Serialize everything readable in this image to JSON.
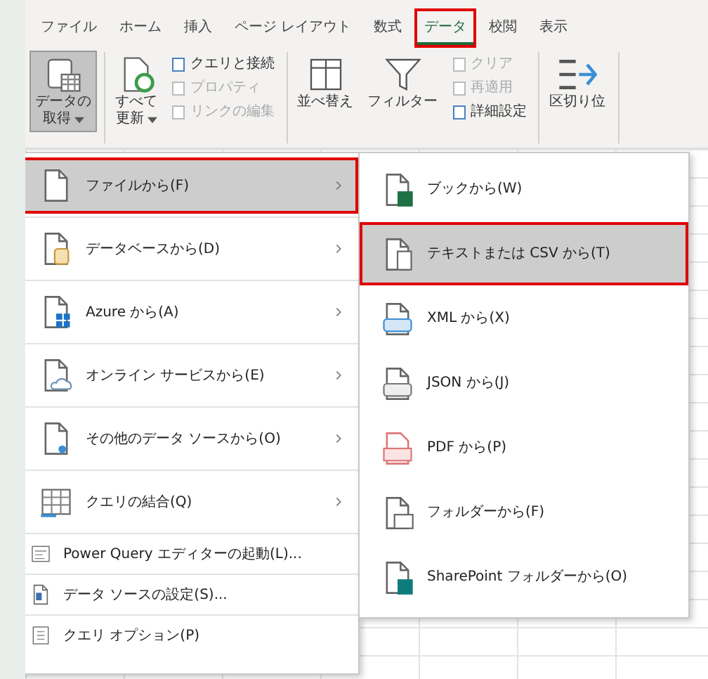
{
  "tabs": [
    {
      "label": "ファイル",
      "selected": false,
      "annotated": false
    },
    {
      "label": "ホーム",
      "selected": false,
      "annotated": false
    },
    {
      "label": "挿入",
      "selected": false,
      "annotated": false
    },
    {
      "label": "ページ レイアウト",
      "selected": false,
      "annotated": false
    },
    {
      "label": "数式",
      "selected": false,
      "annotated": false
    },
    {
      "label": "データ",
      "selected": true,
      "annotated": true
    },
    {
      "label": "校閲",
      "selected": false,
      "annotated": false
    },
    {
      "label": "表示",
      "selected": false,
      "annotated": false
    }
  ],
  "ribbon": {
    "groups": [
      {
        "items": [
          {
            "kind": "large",
            "lines": [
              "データの",
              "取得"
            ],
            "dropdown": true,
            "disabled": false,
            "pressed": true
          }
        ]
      },
      {
        "items": [
          {
            "kind": "large",
            "lines": [
              "すべて",
              "更新"
            ],
            "dropdown": true,
            "disabled": false
          },
          {
            "kind": "small",
            "label": "クエリと接続",
            "disabled": false
          },
          {
            "kind": "small",
            "label": "プロパティ",
            "disabled": true
          },
          {
            "kind": "small",
            "label": "リンクの編集",
            "disabled": true
          }
        ]
      },
      {
        "items": [
          {
            "kind": "large",
            "lines": [
              "並べ替え"
            ],
            "disabled": false
          },
          {
            "kind": "large",
            "lines": [
              "フィルター"
            ],
            "disabled": false
          },
          {
            "kind": "small",
            "label": "クリア",
            "disabled": true
          },
          {
            "kind": "small",
            "label": "再適用",
            "disabled": true
          },
          {
            "kind": "small",
            "label": "詳細設定",
            "disabled": false
          }
        ]
      },
      {
        "items": [
          {
            "kind": "large",
            "lines": [
              "区切り位"
            ],
            "disabled": false
          }
        ]
      }
    ]
  },
  "menu": {
    "items": [
      {
        "kind": "big",
        "label": "ファイルから(F)",
        "submenu": true,
        "selected": true,
        "annotated": true
      },
      {
        "kind": "big",
        "label": "データベースから(D)",
        "submenu": true,
        "selected": false,
        "annotated": false
      },
      {
        "kind": "big",
        "label": "Azure から(A)",
        "submenu": true,
        "selected": false,
        "annotated": false
      },
      {
        "kind": "big",
        "label": "オンライン サービスから(E)",
        "submenu": true,
        "selected": false,
        "annotated": false
      },
      {
        "kind": "big",
        "label": "その他のデータ ソースから(O)",
        "submenu": true,
        "selected": false,
        "annotated": false
      },
      {
        "kind": "big",
        "label": "クエリの結合(Q)",
        "submenu": true,
        "selected": false,
        "annotated": false
      },
      {
        "kind": "small",
        "label": "Power Query エディターの起動(L)...",
        "submenu": false,
        "selected": false,
        "annotated": false
      },
      {
        "kind": "small",
        "label": "データ ソースの設定(S)...",
        "submenu": false,
        "selected": false,
        "annotated": false
      },
      {
        "kind": "small",
        "label": "クエリ オプション(P)",
        "submenu": false,
        "selected": false,
        "annotated": false
      }
    ]
  },
  "submenu": {
    "items": [
      {
        "label": "ブックから(W)",
        "selected": false,
        "annotated": false
      },
      {
        "label": "テキストまたは CSV から(T)",
        "selected": true,
        "annotated": true
      },
      {
        "label": "XML から(X)",
        "selected": false,
        "annotated": false
      },
      {
        "label": "JSON から(J)",
        "selected": false,
        "annotated": false
      },
      {
        "label": "PDF から(P)",
        "selected": false,
        "annotated": false
      },
      {
        "label": "フォルダーから(F)",
        "selected": false,
        "annotated": false
      },
      {
        "label": "SharePoint フォルダーから(O)",
        "selected": false,
        "annotated": false
      }
    ]
  }
}
